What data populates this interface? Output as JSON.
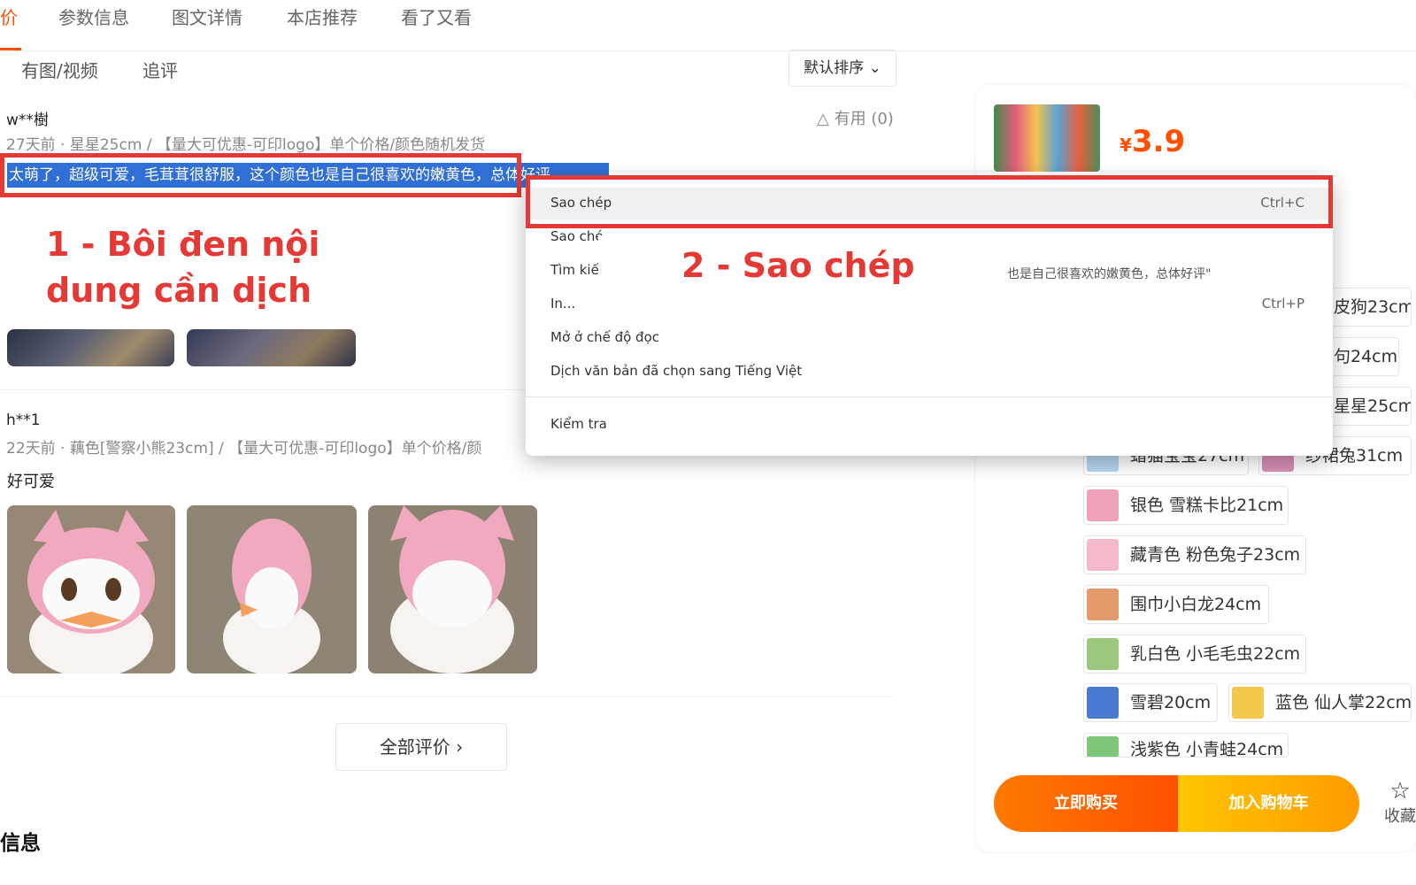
{
  "tabs": {
    "active": "价",
    "items": [
      "参数信息",
      "图文详情",
      "本店推荐",
      "看了又看"
    ]
  },
  "review_filters": {
    "with_media": "有图/视频",
    "follow_up": "追评",
    "sort": "默认排序"
  },
  "reviews": [
    {
      "user": "w**樹",
      "meta": "27天前 · 星星25cm / 【量大可优惠-可印logo】单个价格/颜色随机发货",
      "useful": "有用 (0)",
      "text": "太萌了，超级可爱，毛茸茸很舒服，这个颜色也是自己很喜欢的嫩黄色，总体好评"
    },
    {
      "user": "h**1",
      "meta": "22天前 · 藕色[警察小熊23cm] / 【量大可优惠-可印logo】单个价格/颜",
      "text": "好可爱"
    }
  ],
  "all_reviews_button": "全部评价 ›",
  "section_title": "信息",
  "annotations": {
    "step1_line1": "1 - Bôi đen nội",
    "step1_line2": "dung cần dịch",
    "step2": "2 - Sao chép"
  },
  "context_menu": {
    "items": [
      {
        "label": "Sao chép",
        "shortcut": "Ctrl+C"
      },
      {
        "label": "Sao ché",
        "shortcut": ""
      },
      {
        "label": "Tìm kiế",
        "shortcut": ""
      },
      {
        "label": "In...",
        "shortcut": "Ctrl+P"
      },
      {
        "label": "Mở ở chế độ đọc",
        "shortcut": ""
      },
      {
        "label": "Dịch văn bản đã chọn sang Tiếng Việt",
        "shortcut": ""
      },
      {
        "label": "Kiểm tra",
        "shortcut": ""
      }
    ],
    "search_text": "也是自己很喜欢的嫩黄色，总体好评\""
  },
  "product": {
    "currency": "¥",
    "price": "3.9"
  },
  "skus": [
    "皮狗23cm",
    "句24cm",
    "星星25cm",
    "蜡猫宝宝27cm",
    "纱裙兔31cm",
    "银色 雪糕卡比21cm",
    "藏青色 粉色兔子23cm",
    "围巾小白龙24cm",
    "乳白色 小毛毛虫22cm",
    "雪碧20cm",
    "蓝色 仙人掌22cm",
    "浅紫色 小青蛙24cm"
  ],
  "actions": {
    "buy_now": "立即购买",
    "add_to_cart": "加入购物车",
    "favorite": "收藏"
  },
  "colors": {
    "accent": "#ff5000",
    "annotation_red": "#e53935",
    "selection_blue": "#2f6fd6"
  }
}
